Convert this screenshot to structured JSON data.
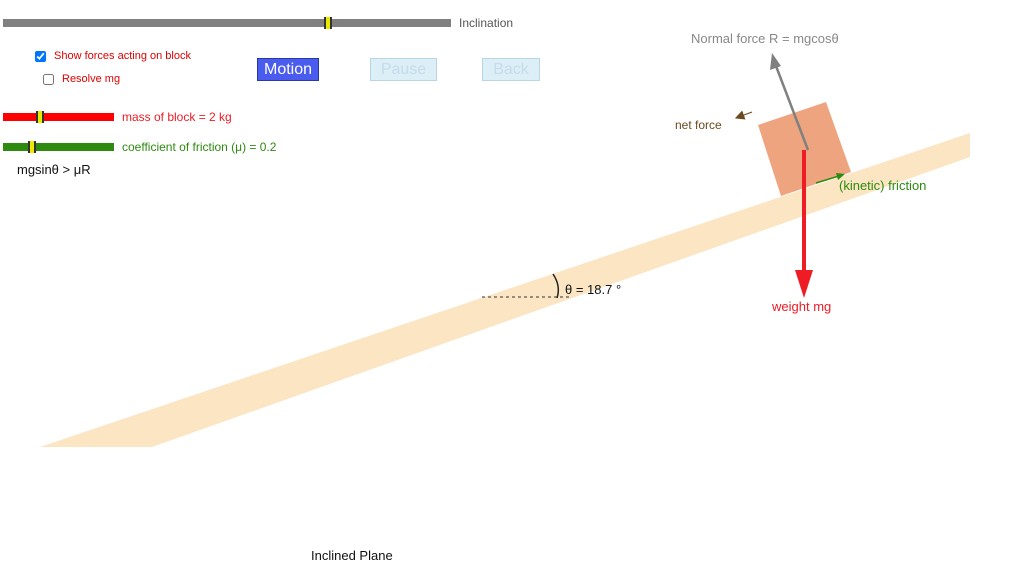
{
  "controls": {
    "inclination": {
      "label": "Inclination",
      "value_fraction": 0.73,
      "track_color": "#808080"
    },
    "show_forces": {
      "label": "Show forces acting on block",
      "checked": true
    },
    "resolve_mg": {
      "label": "Resolve mg",
      "checked": false
    },
    "mass": {
      "label": "mass of block = 2 kg",
      "value_fraction": 0.33,
      "track_color": "#ff0000"
    },
    "friction": {
      "label": "coefficient of friction (μ) = 0.2",
      "value_fraction": 0.25,
      "track_color": "#2e8b0f"
    },
    "condition_text": "mgsinθ > μR"
  },
  "buttons": {
    "motion": "Motion",
    "pause": "Pause",
    "back": "Back"
  },
  "scene": {
    "angle_label": "θ = 18.7 °",
    "normal_force_label": "Normal force R = mgcosθ",
    "net_force_label": "net force",
    "friction_label": "(kinetic) friction",
    "weight_label": "weight mg"
  },
  "footer": {
    "title": "Inclined Plane"
  },
  "colors": {
    "plane": "#fbe5c3",
    "block": "#eea47f",
    "weight": "#ee1c25",
    "normal": "#808080",
    "friction": "#2e8b0f",
    "net_force": "#6b4a1f",
    "mass_label": "#ee1c25",
    "friction_text": "#2e8b0f"
  }
}
